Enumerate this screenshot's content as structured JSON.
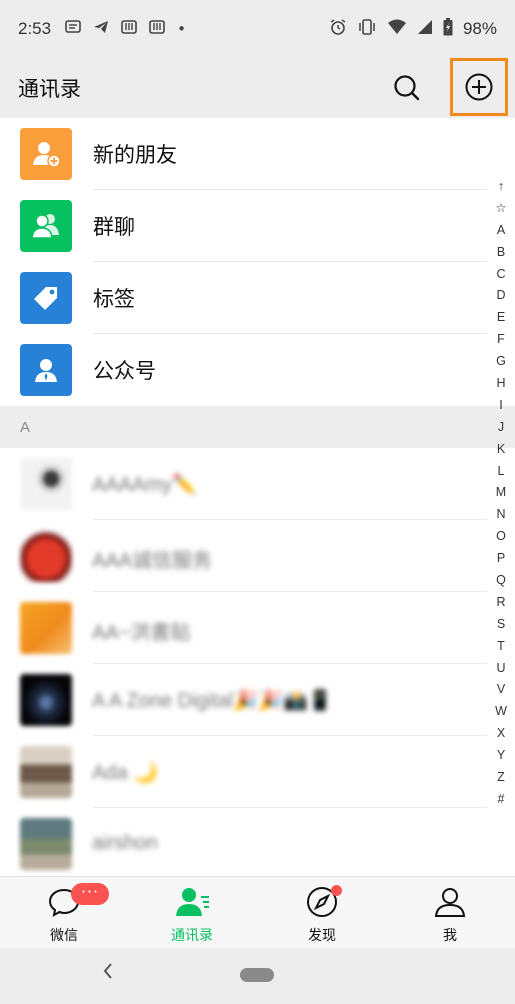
{
  "status_bar": {
    "time": "2:53",
    "dot": "•",
    "battery_pct": "98%"
  },
  "header": {
    "title": "通讯录"
  },
  "functions": [
    {
      "label": "新的朋友",
      "icon": "new-friend-icon",
      "color": "#fa9d3b"
    },
    {
      "label": "群聊",
      "icon": "group-chat-icon",
      "color": "#07c160"
    },
    {
      "label": "标签",
      "icon": "tag-icon",
      "color": "#2782d7"
    },
    {
      "label": "公众号",
      "icon": "official-account-icon",
      "color": "#2782d7"
    }
  ],
  "section_letter": "A",
  "contacts": [
    {
      "name": "AAAAmy✏️",
      "avatar_colors": [
        "#f2f2f2",
        "#cfcfcf"
      ]
    },
    {
      "name": "AAA诚信服务",
      "avatar_colors": [
        "#b0201a",
        "#e33b2a"
      ]
    },
    {
      "name": "AA~洪書贴",
      "avatar_colors": [
        "#f29a1c",
        "#f5a623"
      ]
    },
    {
      "name": "A A Zone Digital🎉🎉📸📱",
      "avatar_colors": [
        "#101018",
        "#22304a"
      ]
    },
    {
      "name": "Ada 🌙",
      "avatar_colors": [
        "#c8b9a6",
        "#6d5a4a"
      ]
    },
    {
      "name": "airshon",
      "avatar_colors": [
        "#5f7a7e",
        "#b7ad9c"
      ]
    }
  ],
  "index_letters": [
    "↑",
    "☆",
    "A",
    "B",
    "C",
    "D",
    "E",
    "F",
    "G",
    "H",
    "I",
    "J",
    "K",
    "L",
    "M",
    "N",
    "O",
    "P",
    "Q",
    "R",
    "S",
    "T",
    "U",
    "V",
    "W",
    "X",
    "Y",
    "Z",
    "#"
  ],
  "tabs": [
    {
      "label": "微信",
      "badge": "···"
    },
    {
      "label": "通讯录"
    },
    {
      "label": "发现"
    },
    {
      "label": "我"
    }
  ],
  "colors": {
    "accent": "#07c160",
    "badge": "#fa5151",
    "highlight": "#f08a1d"
  }
}
